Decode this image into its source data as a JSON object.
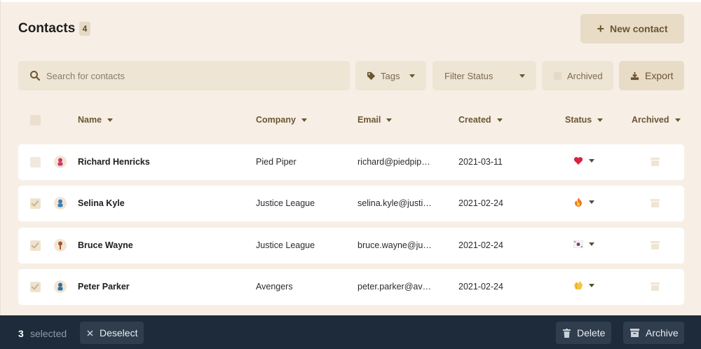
{
  "header": {
    "title": "Contacts",
    "count": "4",
    "new_contact_label": "New contact"
  },
  "toolbar": {
    "search_placeholder": "Search for contacts",
    "tags_label": "Tags",
    "filter_status_label": "Filter Status",
    "archived_label": "Archived",
    "export_label": "Export"
  },
  "table": {
    "columns": {
      "name": "Name",
      "company": "Company",
      "email": "Email",
      "created": "Created",
      "status": "Status",
      "archived": "Archived"
    },
    "rows": [
      {
        "name": "Richard Henricks",
        "company": "Pied Piper",
        "email": "richard@piedpiper.com",
        "created": "2021-03-11",
        "status_icon": "heart-icon",
        "checked": false,
        "avatar_color": "#c93a6b"
      },
      {
        "name": "Selina Kyle",
        "company": "Justice League",
        "email": "selina.kyle@justiceleague.com",
        "created": "2021-02-24",
        "status_icon": "fire-icon",
        "checked": true,
        "avatar_color": "#3b7fb8"
      },
      {
        "name": "Bruce Wayne",
        "company": "Justice League",
        "email": "bruce.wayne@justiceleague.com",
        "created": "2021-02-24",
        "status_icon": "flag-icon",
        "checked": true,
        "avatar_color": "#a8542c"
      },
      {
        "name": "Peter Parker",
        "company": "Avengers",
        "email": "peter.parker@avengers.com",
        "created": "2021-02-24",
        "status_icon": "clap-icon",
        "checked": true,
        "avatar_color": "#2f6fa8"
      }
    ]
  },
  "bottom_bar": {
    "selected_count": "3",
    "selected_label": "selected",
    "deselect_label": "Deselect",
    "delete_label": "Delete",
    "archive_label": "Archive"
  },
  "colors": {
    "background": "#f7efe6",
    "accent": "#6b5631",
    "bottom_bar": "#1e2b3a"
  }
}
